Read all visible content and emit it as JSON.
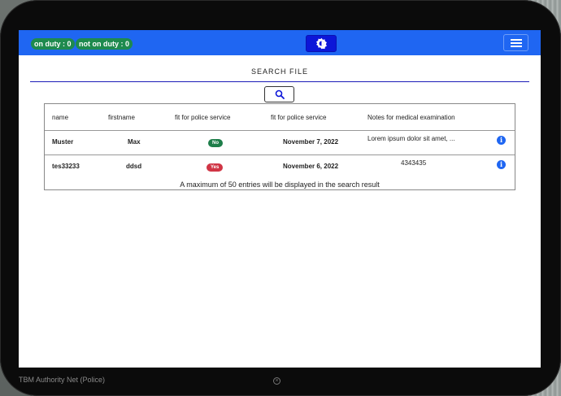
{
  "status": {
    "on_duty": "on duty : 0",
    "not_on_duty": "not on duty : 0"
  },
  "header": {
    "theme_toggle_icon": "brightness-icon",
    "menu_icon": "hamburger-icon"
  },
  "search": {
    "title": "SEARCH FILE",
    "button_icon": "search-icon"
  },
  "table": {
    "columns": [
      "name",
      "firstname",
      "fit for police service",
      "fit for police service",
      "Notes for medical examination"
    ],
    "rows": [
      {
        "name": "Muster",
        "firstname": "Max",
        "fit_badge": "No",
        "fit_badge_color": "#1e7e4a",
        "date": "November 7, 2022",
        "notes": "Lorem ipsum dolor sit amet, ..."
      },
      {
        "name": "tes33233",
        "firstname": "ddsd",
        "fit_badge": "Yes",
        "fit_badge_color": "#d03545",
        "date": "November 6, 2022",
        "notes": "4343435"
      }
    ],
    "footer_note": "A maximum of 50 entries will be displayed in the search result"
  },
  "device": {
    "footer_label": "TBM Authority Net (Police)"
  },
  "colors": {
    "topbar": "#1f66f2",
    "accent": "#0c16d8",
    "on_duty": "#1e8a4e"
  }
}
